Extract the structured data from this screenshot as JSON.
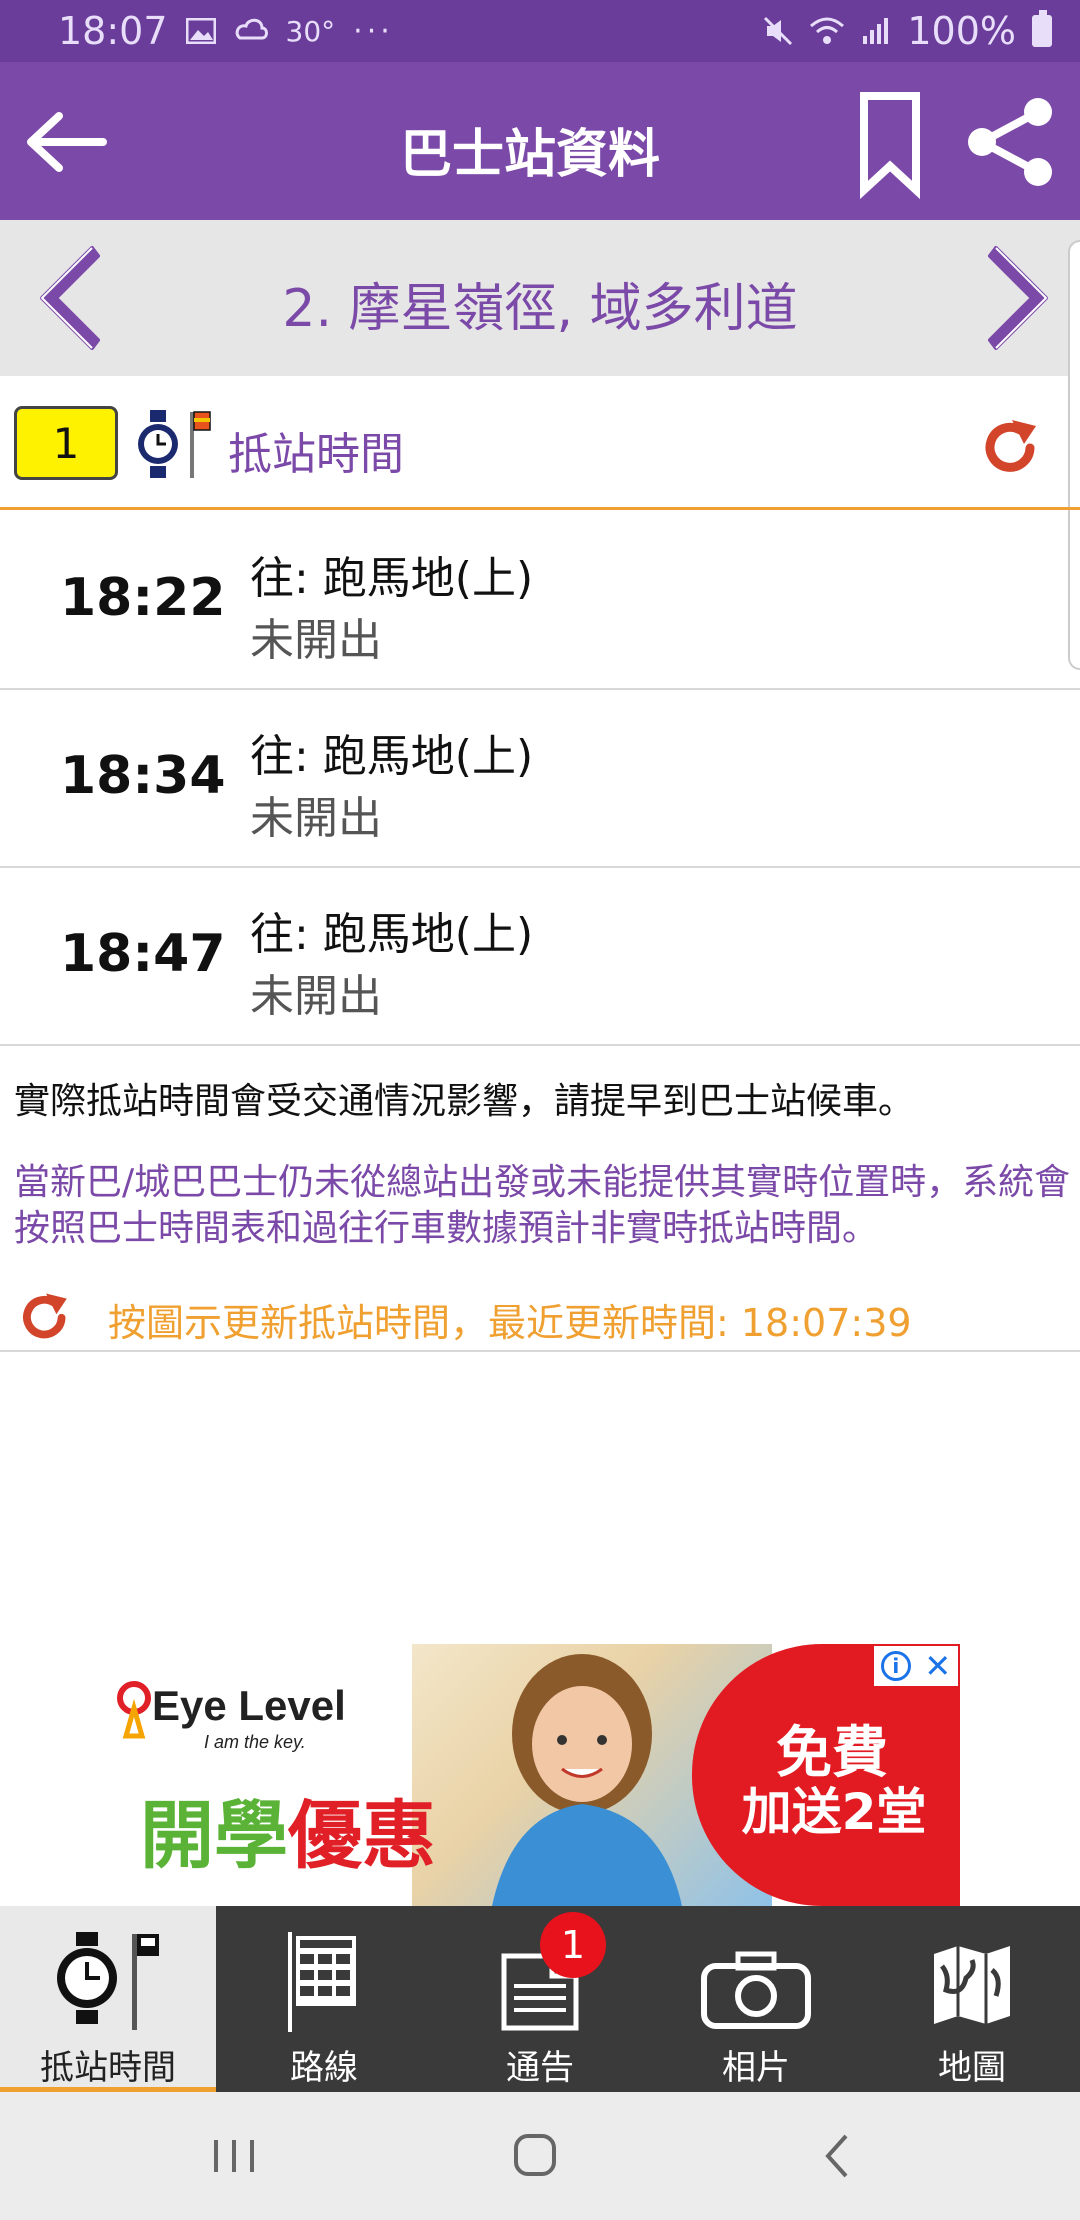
{
  "status_bar": {
    "time": "18:07",
    "temperature": "30°",
    "more": "···",
    "battery": "100%"
  },
  "app_bar": {
    "title": "巴士站資料"
  },
  "stop_nav": {
    "stop_name": "2. 摩星嶺徑, 域多利道"
  },
  "eta_header": {
    "route": "1",
    "label": "抵站時間"
  },
  "etas": [
    {
      "time": "18:22",
      "destination": "往: 跑馬地(上)",
      "status": "未開出"
    },
    {
      "time": "18:34",
      "destination": "往: 跑馬地(上)",
      "status": "未開出"
    },
    {
      "time": "18:47",
      "destination": "往: 跑馬地(上)",
      "status": "未開出"
    }
  ],
  "notes": {
    "traffic": "實際抵站時間會受交通情況影響，請提早到巴士站候車。",
    "schedule": "當新巴/城巴巴士仍未從總站出發或未能提供其實時位置時，系統會按照巴士時間表和過往行車數據預計非實時抵站時間。",
    "update": "按圖示更新抵站時間，最近更新時間: 18:07:39"
  },
  "ad": {
    "brand": "Eye Level",
    "tagline": "I am the key.",
    "slogan_green": "開學",
    "slogan_red": "優惠",
    "offer_line1": "免費",
    "offer_line2": "加送2堂",
    "info": "i",
    "close": "✕"
  },
  "bottom_nav": [
    {
      "label": "抵站時間",
      "icon": "clock-stop-icon",
      "active": true
    },
    {
      "label": "路線",
      "icon": "timetable-icon",
      "active": false
    },
    {
      "label": "通告",
      "icon": "notice-icon",
      "active": false,
      "badge": "1"
    },
    {
      "label": "相片",
      "icon": "camera-icon",
      "active": false
    },
    {
      "label": "地圖",
      "icon": "map-icon",
      "active": false
    }
  ],
  "colors": {
    "primary": "#7b49a8",
    "status_bar": "#6a3d9a",
    "accent": "#f0a030",
    "route_badge": "#fff200",
    "refresh": "#d2452b",
    "nav_bg": "#3a3a3a"
  }
}
